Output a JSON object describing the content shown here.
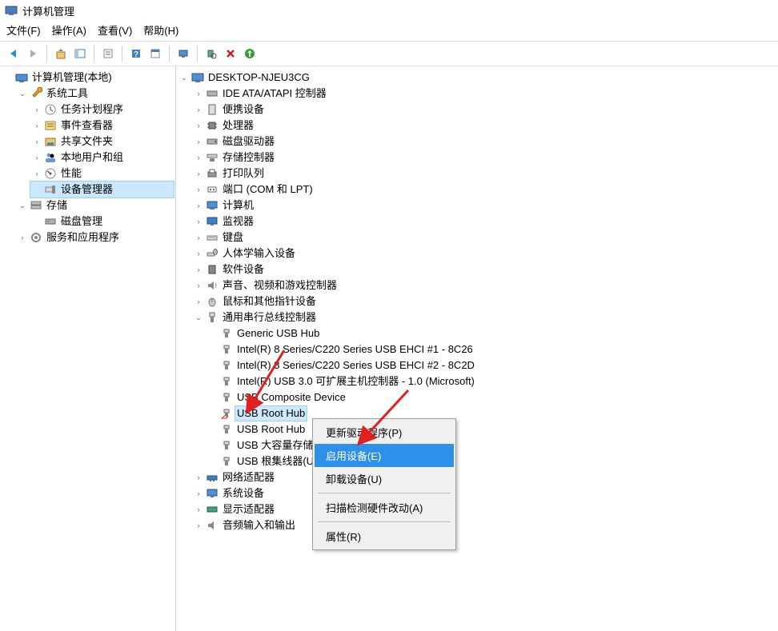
{
  "title": "计算机管理",
  "menu": {
    "file": "文件(F)",
    "action": "操作(A)",
    "view": "查看(V)",
    "help": "帮助(H)"
  },
  "left": {
    "root": "计算机管理(本地)",
    "system_tools": "系统工具",
    "task_scheduler": "任务计划程序",
    "event_viewer": "事件查看器",
    "shared_folders": "共享文件夹",
    "local_users": "本地用户和组",
    "performance": "性能",
    "device_manager": "设备管理器",
    "storage": "存储",
    "disk_mgmt": "磁盘管理",
    "services": "服务和应用程序"
  },
  "right": {
    "root": "DESKTOP-NJEU3CG",
    "ide": "IDE ATA/ATAPI 控制器",
    "portable": "便携设备",
    "cpu": "处理器",
    "disk": "磁盘驱动器",
    "storage_ctrl": "存储控制器",
    "print_queue": "打印队列",
    "ports": "端口 (COM 和 LPT)",
    "computer": "计算机",
    "monitor": "监视器",
    "keyboard": "键盘",
    "hid": "人体学输入设备",
    "software_dev": "软件设备",
    "sound": "声音、视频和游戏控制器",
    "mouse": "鼠标和其他指针设备",
    "usb_ctrl": "通用串行总线控制器",
    "usb0": "Generic USB Hub",
    "usb1": "Intel(R) 8 Series/C220 Series USB EHCI #1 - 8C26",
    "usb2": "Intel(R) 8 Series/C220 Series USB EHCI #2 - 8C2D",
    "usb3": "Intel(R) USB 3.0 可扩展主机控制器 - 1.0 (Microsoft)",
    "usb4": "USB Composite Device",
    "usb5": "USB Root Hub",
    "usb6": "USB Root Hub",
    "usb7": "USB 大容量存储设备",
    "usb8": "USB 根集线器(USB 3.0)",
    "network": "网络适配器",
    "sys_dev": "系统设备",
    "display_adapter": "显示适配器",
    "audio": "音频输入和输出"
  },
  "context": {
    "update_driver": "更新驱动程序(P)",
    "enable": "启用设备(E)",
    "uninstall": "卸载设备(U)",
    "scan": "扫描检测硬件改动(A)",
    "properties": "属性(R)"
  }
}
